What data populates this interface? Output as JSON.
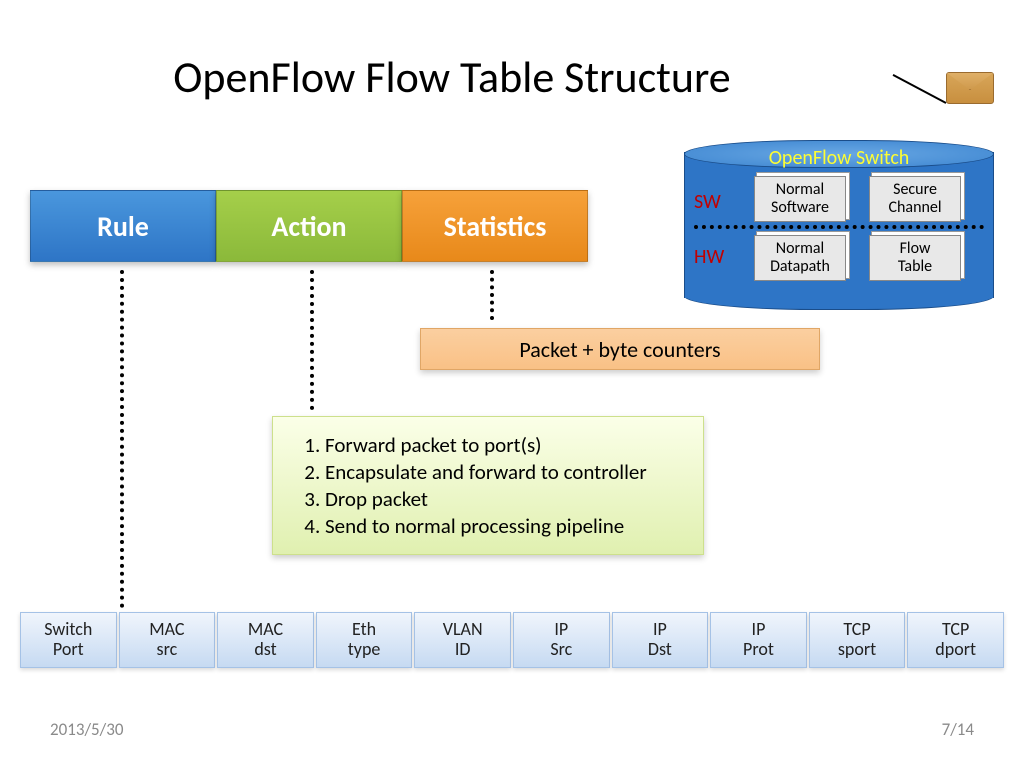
{
  "title": "OpenFlow Flow Table Structure",
  "switch": {
    "title": "OpenFlow Switch",
    "sw_label": "SW",
    "hw_label": "HW",
    "boxes": {
      "normal_software_l1": "Normal",
      "normal_software_l2": "Software",
      "secure_channel_l1": "Secure",
      "secure_channel_l2": "Channel",
      "normal_datapath_l1": "Normal",
      "normal_datapath_l2": "Datapath",
      "flow_table_l1": "Flow",
      "flow_table_l2": "Table"
    }
  },
  "triple": {
    "rule": "Rule",
    "action": "Action",
    "stats": "Statistics"
  },
  "stats_detail": "Packet + byte counters",
  "action_detail": {
    "item1": "Forward packet to port(s)",
    "item2": "Encapsulate and forward to controller",
    "item3": "Drop packet",
    "item4": "Send to normal processing pipeline"
  },
  "rule_fields": {
    "f0a": "Switch",
    "f0b": "Port",
    "f1a": "MAC",
    "f1b": "src",
    "f2a": "MAC",
    "f2b": "dst",
    "f3a": "Eth",
    "f3b": "type",
    "f4a": "VLAN",
    "f4b": "ID",
    "f5a": "IP",
    "f5b": "Src",
    "f6a": "IP",
    "f6b": "Dst",
    "f7a": "IP",
    "f7b": "Prot",
    "f8a": "TCP",
    "f8b": "sport",
    "f9a": "TCP",
    "f9b": "dport"
  },
  "footer": {
    "date": "2013/5/30",
    "page": "7/14"
  }
}
